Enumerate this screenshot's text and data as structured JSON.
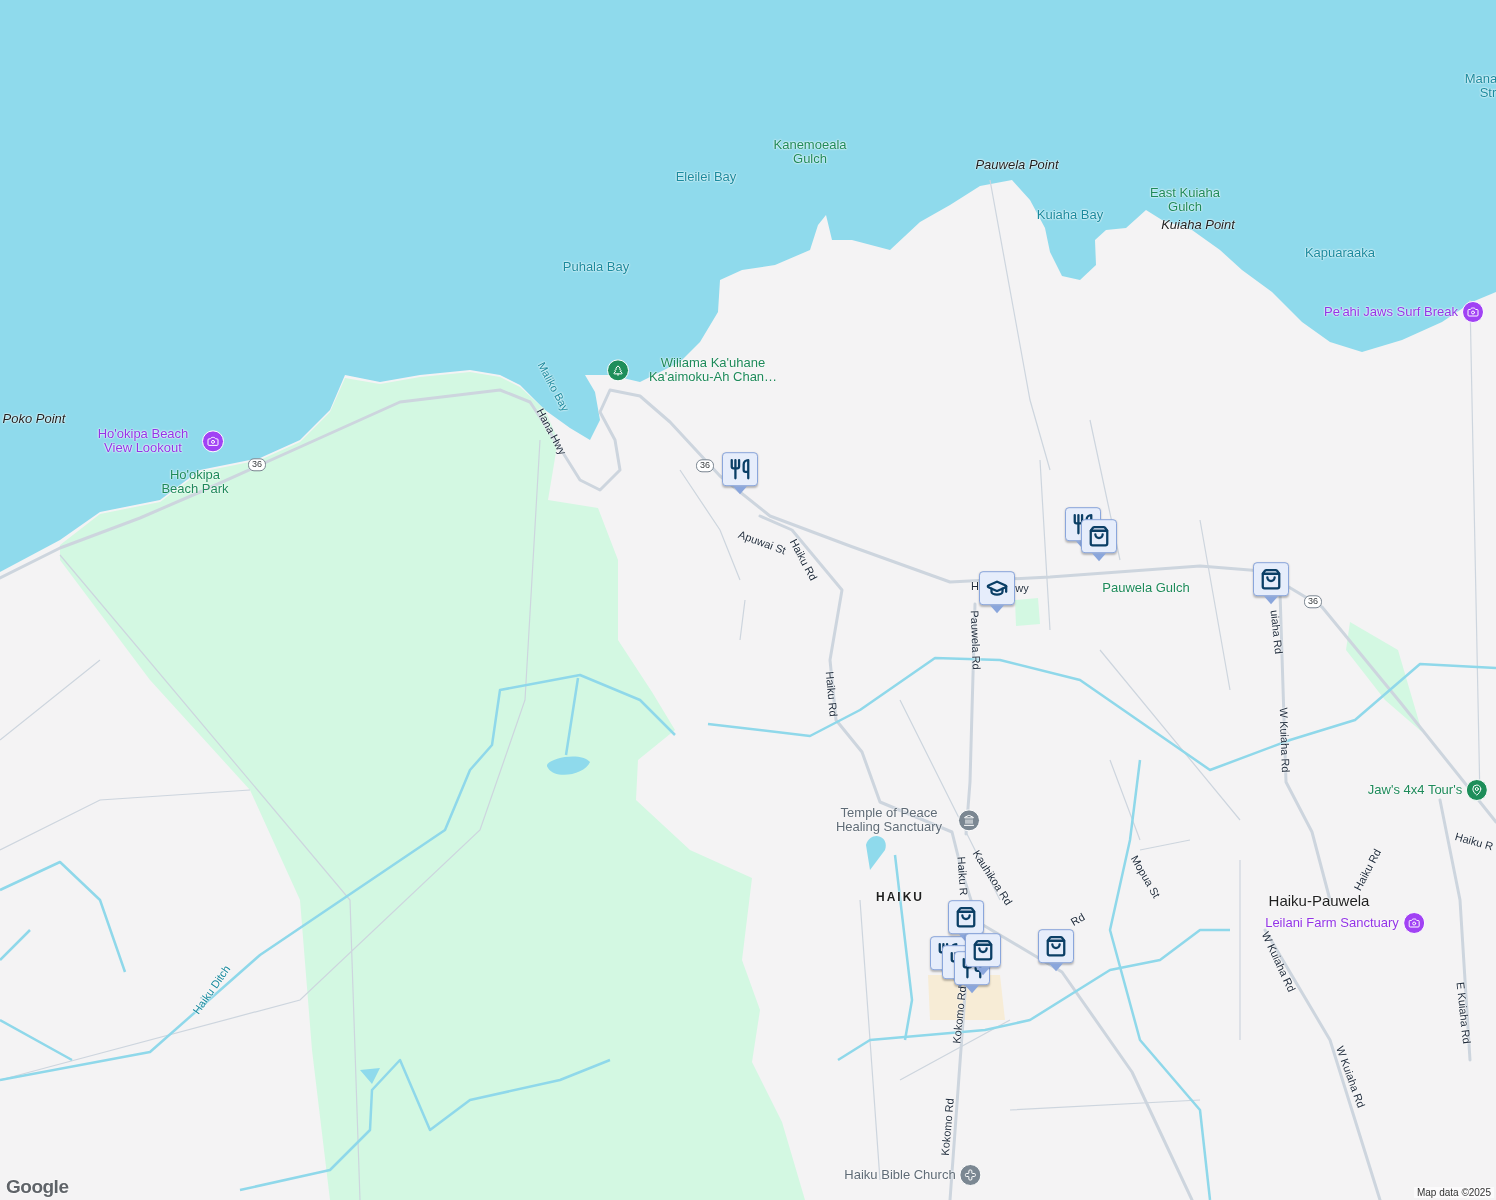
{
  "map": {
    "labels": [
      {
        "text": "Mana",
        "kind": "water"
      },
      {
        "text": "Str",
        "kind": "water"
      },
      {
        "text": "Kanemoeala Gulch",
        "kind": "natural"
      },
      {
        "text": "Eleilei Bay",
        "kind": "water"
      },
      {
        "text": "Pauwela Point",
        "kind": "headland"
      },
      {
        "text": "East Kuiaha Gulch",
        "kind": "natural"
      },
      {
        "text": "Kuiaha Bay",
        "kind": "water"
      },
      {
        "text": "Kuiaha Point",
        "kind": "headland"
      },
      {
        "text": "Kapuaraaka",
        "kind": "water"
      },
      {
        "text": "Puhala Bay",
        "kind": "water"
      },
      {
        "text": "Pe'ahi Jaws Surf Break",
        "kind": "attraction"
      },
      {
        "text": "Wiliama Ka'uhane Ka'aimoku-Ah Chan…",
        "kind": "park_site"
      },
      {
        "text": "Maliko Bay",
        "kind": "stream"
      },
      {
        "text": "Poko Point",
        "kind": "headland"
      },
      {
        "text": "Ho'okipa Beach View Lookout",
        "kind": "attraction"
      },
      {
        "text": "Hana Hwy",
        "kind": "road"
      },
      {
        "text": "Ho'okipa Beach Park",
        "kind": "natural"
      },
      {
        "text": "36",
        "kind": "shield"
      },
      {
        "text": "36",
        "kind": "shield"
      },
      {
        "text": "Apuwai St",
        "kind": "road"
      },
      {
        "text": "Haiku Rd",
        "kind": "road"
      },
      {
        "text": "H",
        "kind": "road"
      },
      {
        "text": "wy",
        "kind": "road"
      },
      {
        "text": "Pauwela Gulch",
        "kind": "natural"
      },
      {
        "text": "36",
        "kind": "shield"
      },
      {
        "text": "uiaha Rd",
        "kind": "road"
      },
      {
        "text": "Pauwela Rd",
        "kind": "road"
      },
      {
        "text": "Haiku Rd",
        "kind": "road"
      },
      {
        "text": "W Kuiaha Rd",
        "kind": "road"
      },
      {
        "text": "Jaw's 4x4 Tour's",
        "kind": "business"
      },
      {
        "text": "Temple of Peace Healing Sanctuary",
        "kind": "temple"
      },
      {
        "text": "Haiku R",
        "kind": "road"
      },
      {
        "text": "Kauhikoa Rd",
        "kind": "road"
      },
      {
        "text": "Mopua St",
        "kind": "road"
      },
      {
        "text": "Haiku Rd",
        "kind": "road"
      },
      {
        "text": "Haiku R",
        "kind": "road"
      },
      {
        "text": "HAIKU",
        "kind": "town"
      },
      {
        "text": "Haiku-Pauwela",
        "kind": "town"
      },
      {
        "text": "Leilani Farm Sanctuary",
        "kind": "attraction"
      },
      {
        "text": "Rd",
        "kind": "road"
      },
      {
        "text": "Haiku Ditch",
        "kind": "stream"
      },
      {
        "text": "W Kuiaha Rd",
        "kind": "road"
      },
      {
        "text": "E Kuiaha Rd",
        "kind": "road"
      },
      {
        "text": "Kokomo Rd",
        "kind": "road"
      },
      {
        "text": "Kokomo Rd",
        "kind": "road"
      },
      {
        "text": "W Kuiaha Rd",
        "kind": "road"
      },
      {
        "text": "Haiku Bible Church",
        "kind": "church"
      }
    ],
    "markers": [
      {
        "kind": "restaurant"
      },
      {
        "kind": "restaurant"
      },
      {
        "kind": "shopping"
      },
      {
        "kind": "school"
      },
      {
        "kind": "shopping"
      },
      {
        "kind": "shopping"
      },
      {
        "kind": "restaurant"
      },
      {
        "kind": "shopping"
      },
      {
        "kind": "restaurant"
      },
      {
        "kind": "restaurant"
      },
      {
        "kind": "shopping"
      }
    ],
    "logo": "Google",
    "attribution": "Map data ©2025"
  }
}
